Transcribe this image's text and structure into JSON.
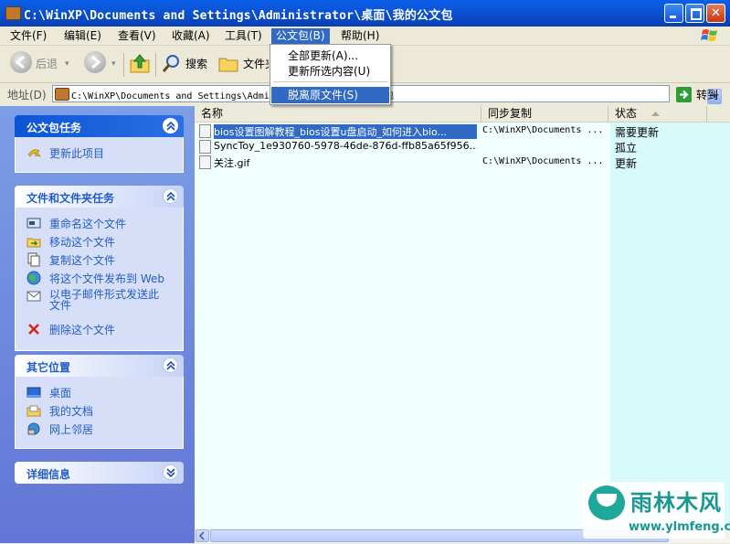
{
  "window": {
    "title": "C:\\WinXP\\Documents and Settings\\Administrator\\桌面\\我的公文包"
  },
  "menubar": [
    {
      "label": "文件(F)"
    },
    {
      "label": "编辑(E)"
    },
    {
      "label": "查看(V)"
    },
    {
      "label": "收藏(A)"
    },
    {
      "label": "工具(T)"
    },
    {
      "label": "公文包(B)"
    },
    {
      "label": "帮助(H)"
    }
  ],
  "menu_dropdown": {
    "items": [
      {
        "label": "全部更新(A)..."
      },
      {
        "label": "更新所选内容(U)"
      },
      {
        "label": "脱离原文件(S)"
      }
    ],
    "highlighted": "脱离原文件(S)"
  },
  "toolbar": {
    "back_label": "后退",
    "search_label": "搜索",
    "folders_label": "文件夹"
  },
  "address": {
    "label": "地址(D)",
    "value": "C:\\WinXP\\Documents and Settings\\Administrator\\桌面\\我的公文包",
    "go_label": "转到"
  },
  "tasks": {
    "briefcase": {
      "title": "公文包任务",
      "items": [
        "更新此项目"
      ]
    },
    "file": {
      "title": "文件和文件夹任务",
      "items": [
        "重命名这个文件",
        "移动这个文件",
        "复制这个文件",
        "将这个文件发布到 Web",
        "以电子邮件形式发送此文件",
        "删除这个文件"
      ]
    },
    "places": {
      "title": "其它位置",
      "items": [
        "桌面",
        "我的文档",
        "网上邻居"
      ]
    },
    "details": {
      "title": "详细信息"
    }
  },
  "filelist": {
    "columns": [
      "名称",
      "同步复制",
      "状态"
    ],
    "rows": [
      {
        "name": "bios设置图解教程_bios设置u盘启动_如何进入bio...",
        "sync": "C:\\WinXP\\Documents ...",
        "status": "需要更新",
        "selected": true
      },
      {
        "name": "SyncToy_1e930760-5978-46de-876d-ffb85a65f956...",
        "sync": "",
        "status": "孤立",
        "selected": false
      },
      {
        "name": "关注.gif",
        "sync": "C:\\WinXP\\Documents ...",
        "status": "更新",
        "selected": false
      }
    ]
  },
  "watermark": {
    "brand": "雨林木风",
    "url": "www.ylmfeng.com"
  },
  "colors": {
    "titlebar": "#0b54d6",
    "selection": "#316ac5",
    "taskpane": "#6f8fe0",
    "panel_link": "#215dc6"
  }
}
